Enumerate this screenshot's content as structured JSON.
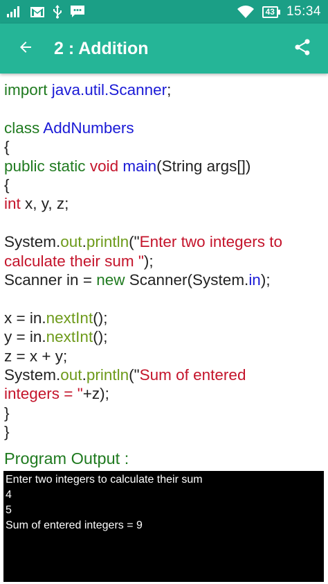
{
  "status_bar": {
    "battery": "43",
    "time": "15:34"
  },
  "app_bar": {
    "title": "2 : Addition"
  },
  "code_lines": [
    [
      {
        "t": "import ",
        "c": "kw"
      },
      {
        "t": "java.util.Scanner",
        "c": "blue"
      },
      {
        "t": ";",
        "c": "plain"
      }
    ],
    [],
    [
      {
        "t": "class ",
        "c": "kw"
      },
      {
        "t": "AddNumbers",
        "c": "blue"
      }
    ],
    [
      {
        "t": "{",
        "c": "plain"
      }
    ],
    [
      {
        "t": "public static ",
        "c": "kw"
      },
      {
        "t": "void ",
        "c": "str"
      },
      {
        "t": "main",
        "c": "blue"
      },
      {
        "t": "(String args[])",
        "c": "plain"
      }
    ],
    [
      {
        "t": "{",
        "c": "plain"
      }
    ],
    [
      {
        "t": "int ",
        "c": "str"
      },
      {
        "t": "x, y, z;",
        "c": "plain"
      }
    ],
    [],
    [
      {
        "t": "System.",
        "c": "plain"
      },
      {
        "t": "out",
        "c": "olive"
      },
      {
        "t": ".",
        "c": "plain"
      },
      {
        "t": "println",
        "c": "olive"
      },
      {
        "t": "(\"",
        "c": "plain"
      },
      {
        "t": "Enter two integers to",
        "c": "str"
      }
    ],
    [
      {
        "t": "calculate their sum \"",
        "c": "str"
      },
      {
        "t": ");",
        "c": "plain"
      }
    ],
    [
      {
        "t": "Scanner in = ",
        "c": "plain"
      },
      {
        "t": "new ",
        "c": "kw"
      },
      {
        "t": "Scanner(System.",
        "c": "plain"
      },
      {
        "t": "in",
        "c": "blue"
      },
      {
        "t": ");",
        "c": "plain"
      }
    ],
    [],
    [
      {
        "t": "x = in.",
        "c": "plain"
      },
      {
        "t": "nextInt",
        "c": "olive"
      },
      {
        "t": "();",
        "c": "plain"
      }
    ],
    [
      {
        "t": "y = in.",
        "c": "plain"
      },
      {
        "t": "nextInt",
        "c": "olive"
      },
      {
        "t": "();",
        "c": "plain"
      }
    ],
    [
      {
        "t": "z = x + y;",
        "c": "plain"
      }
    ],
    [
      {
        "t": "System.",
        "c": "plain"
      },
      {
        "t": "out",
        "c": "olive"
      },
      {
        "t": ".",
        "c": "plain"
      },
      {
        "t": "println",
        "c": "olive"
      },
      {
        "t": "(\"",
        "c": "plain"
      },
      {
        "t": "Sum of entered",
        "c": "str"
      }
    ],
    [
      {
        "t": "integers = \"",
        "c": "str"
      },
      {
        "t": "+z);",
        "c": "plain"
      }
    ],
    [
      {
        "t": "}",
        "c": "plain"
      }
    ],
    [
      {
        "t": "}",
        "c": "plain"
      }
    ]
  ],
  "output": {
    "title": "Program Output :",
    "lines": [
      "Enter two integers to calculate their sum",
      "4",
      "5",
      "Sum of entered integers = 9"
    ]
  }
}
